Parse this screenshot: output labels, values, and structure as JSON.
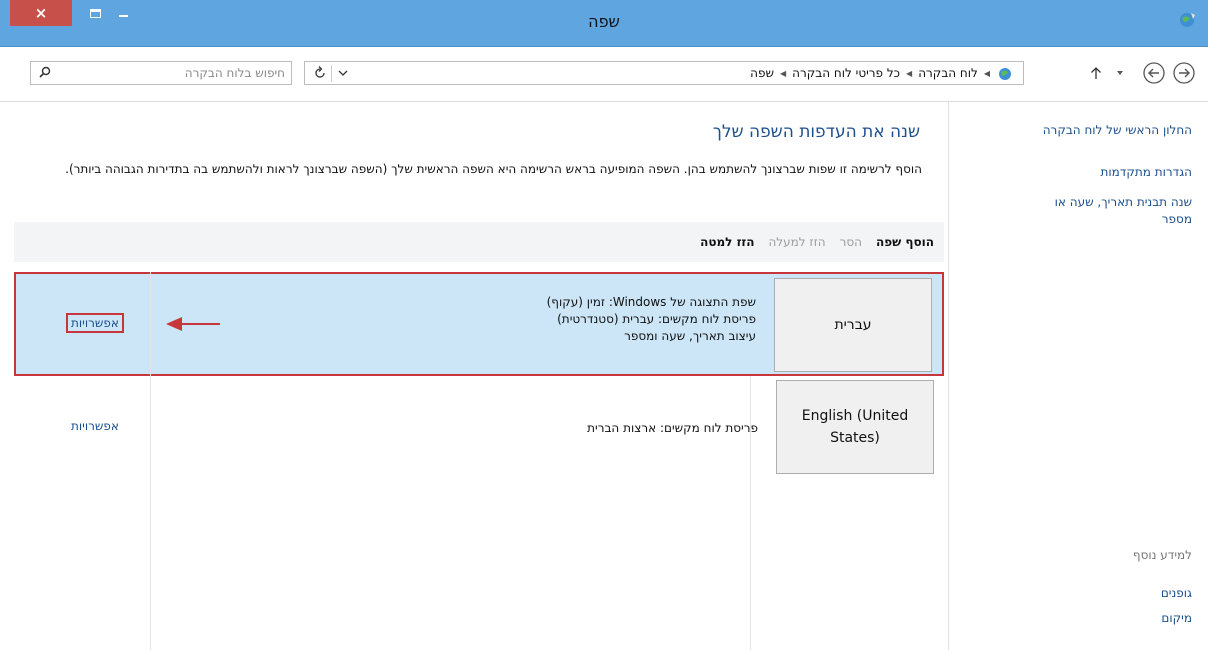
{
  "window": {
    "title": "שפה",
    "close_glyph": "×",
    "colors": {
      "titlebar": "#5fa5df",
      "close": "#c7504a",
      "highlight": "#cde6f7",
      "annotation": "#c6363b"
    }
  },
  "nav": {
    "search_placeholder": "חיפוש בלוח הבקרה",
    "breadcrumbs": [
      "לוח הבקרה",
      "כל פריטי לוח הבקרה",
      "שפה"
    ]
  },
  "sidebar": {
    "links": [
      "החלון הראשי של לוח הבקרה",
      "הגדרות מתקדמות",
      "שנה תבנית תאריך, שעה או מספר"
    ],
    "see_also_heading": "למידע נוסף",
    "see_also": [
      "גופנים",
      "מיקום"
    ]
  },
  "main": {
    "title": "שנה את העדפות השפה שלך",
    "description": "הוסף לרשימה זו שפות שברצונך להשתמש בהן. השפה המופיעה בראש הרשימה היא השפה הראשית שלך (השפה שברצונך לראות ולהשתמש בה בתדירות הגבוהה ביותר).",
    "toolbar": {
      "add": "הוסף שפה",
      "remove": "הסר",
      "move_up": "הזז למעלה",
      "move_down": "הזז למטה"
    },
    "languages": [
      {
        "name": "עברית",
        "details": [
          "שפת התצוגה של Windows: זמין (עקוף)",
          "פריסת לוח מקשים: עברית (סטנדרטית)",
          "עיצוב תאריך, שעה ומספר"
        ],
        "options": "אפשרויות"
      },
      {
        "name": "English (United States)",
        "details": [
          "פריסת לוח מקשים: ארצות הברית"
        ],
        "options": "אפשרויות"
      }
    ]
  }
}
